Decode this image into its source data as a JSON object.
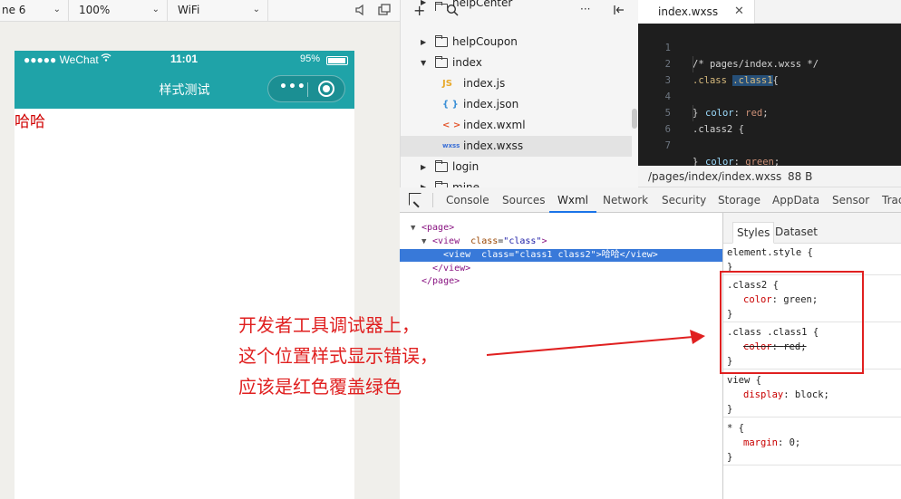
{
  "simulator_toolbar": {
    "device": "ne 6",
    "zoom": "100%",
    "network": "WiFi"
  },
  "phone": {
    "carrier": "●●●●● WeChat",
    "time": "11:01",
    "battery": "95%",
    "battery_level": 0.95,
    "nav_title": "样式测试",
    "capsule_dots": "•••",
    "content_text": "哈哈",
    "accent_color": "#1fa3a8"
  },
  "file_tree": {
    "items": [
      {
        "label": "helpCenter",
        "kind": "folder"
      },
      {
        "label": "helpCoupon",
        "kind": "folder"
      },
      {
        "label": "index",
        "kind": "folder-open"
      },
      {
        "label": "index.js",
        "kind": "js",
        "tag": "JS"
      },
      {
        "label": "index.json",
        "kind": "json",
        "tag": "{ }"
      },
      {
        "label": "index.wxml",
        "kind": "wxml",
        "tag": "< >"
      },
      {
        "label": "index.wxss",
        "kind": "wxss",
        "tag": "wxss"
      },
      {
        "label": "login",
        "kind": "folder"
      },
      {
        "label": "mine",
        "kind": "folder"
      }
    ]
  },
  "editor": {
    "tab_name": "index.wxss",
    "line_numbers": [
      "1",
      "2",
      "3",
      "4",
      "5",
      "6",
      "7"
    ],
    "code": {
      "l1": "/* pages/index.wxss */",
      "l2_sel": ".class ",
      "l2_hl": ".class1",
      "l2_rest": "{",
      "l3_prop": "color",
      "l3_val": "red",
      "l4": "}",
      "l5": ".class2 {",
      "l6_prop": "color",
      "l6_val": "green",
      "l7": "}"
    },
    "status_path": "/pages/index/index.wxss",
    "status_size": "88 B"
  },
  "devtools": {
    "tabs": [
      "Console",
      "Sources",
      "Wxml",
      "Network",
      "Security",
      "Storage",
      "AppData",
      "Sensor",
      "Trac"
    ],
    "active_tab": "Wxml",
    "wxml": {
      "page_open": "<page>",
      "view_open_tag": "<view",
      "view_open_attr": "class",
      "view_open_val": "\"class\"",
      "child_tag": "<view",
      "child_attr": "class",
      "child_val": "\"class1 class2\"",
      "child_text": "哈哈",
      "child_close": "</view>",
      "view_close": "</view>",
      "page_close": "</page>"
    },
    "styles_tabs": [
      "Styles",
      "Dataset"
    ],
    "rules": {
      "element_style": "element.style {",
      "class2_sel": ".class2 {",
      "class2_prop": "color",
      "class2_val": "green;",
      "class_class1_sel": ".class .class1 {",
      "class_class1_prop": "color",
      "class_class1_val": "red;",
      "view_sel": "view {",
      "view_prop": "display",
      "view_val": "block;",
      "star_sel": "* {",
      "star_prop": "margin",
      "star_val": "0;",
      "close": "}"
    }
  },
  "annotation": {
    "line1": "开发者工具调试器上，",
    "line2": "这个位置样式显示错误，",
    "line3": "应该是红色覆盖绿色",
    "color": "#e02020"
  }
}
